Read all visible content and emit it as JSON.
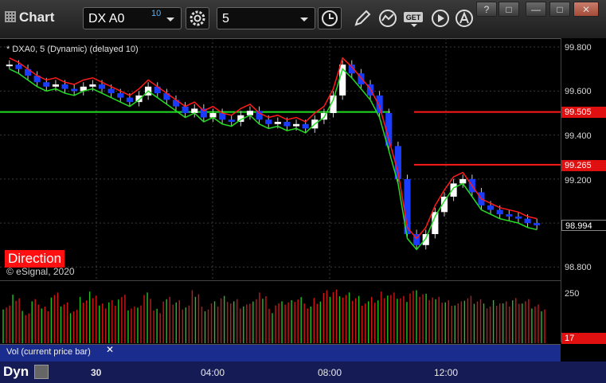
{
  "toolbar": {
    "title": "Chart",
    "symbol": "DX A0",
    "symbol_superscript": "10",
    "interval": "5",
    "window_buttons": [
      "?",
      "□",
      "—",
      "□",
      "✕"
    ]
  },
  "legend": "* DXA0, 5 (Dynamic) (delayed 10)",
  "indicator_label": "Direction",
  "copyright": "© eSignal, 2020",
  "volume_pane": {
    "label": "Vol (current price bar)",
    "close": "✕",
    "y_label": "250",
    "last_tag": "17"
  },
  "bottom": {
    "dyn_label": "Dyn"
  },
  "price_tags": [
    {
      "label": "99.505",
      "color": "#e01010"
    },
    {
      "label": "99.265",
      "color": "#e01010"
    },
    {
      "label": "98.994",
      "color": "#ffffff"
    }
  ],
  "colors": {
    "up": "#ffffff",
    "down": "#1a3cff",
    "red_line": "#ff1a1a",
    "green_line": "#22dd22",
    "vol_up": "#22c022",
    "vol_down": "#d01515"
  },
  "chart_data": {
    "type": "candlestick",
    "ylim": [
      98.74,
      99.84
    ],
    "y_ticks": [
      "99.800",
      "99.600",
      "99.400",
      "99.200",
      "98.800"
    ],
    "x_ticks": [
      "30",
      "04:00",
      "08:00",
      "12:00"
    ],
    "horizontal_levels": [
      {
        "value": 99.505,
        "color": "#ff1a1a"
      },
      {
        "value": 99.265,
        "color": "#ff1a1a"
      }
    ],
    "green_level": 99.505,
    "close_series": [
      99.72,
      99.7,
      99.67,
      99.64,
      99.62,
      99.63,
      99.61,
      99.6,
      99.62,
      99.63,
      99.61,
      99.59,
      99.57,
      99.55,
      99.58,
      99.62,
      99.59,
      99.56,
      99.53,
      99.5,
      99.52,
      99.48,
      99.5,
      99.47,
      99.46,
      99.49,
      99.51,
      99.47,
      99.45,
      99.46,
      99.44,
      99.45,
      99.43,
      99.47,
      99.5,
      99.58,
      99.72,
      99.68,
      99.63,
      99.58,
      99.5,
      99.35,
      99.2,
      98.95,
      98.9,
      98.95,
      99.05,
      99.12,
      99.18,
      99.2,
      99.14,
      99.08,
      99.06,
      99.04,
      99.03,
      99.02,
      99.0,
      98.99
    ],
    "volume_series": [
      180,
      220,
      150,
      200,
      170,
      230,
      190,
      160,
      210,
      240,
      180,
      200,
      220,
      170,
      190,
      230,
      160,
      210,
      200,
      180,
      240,
      170,
      190,
      220,
      200,
      180,
      210,
      230,
      160,
      190,
      200,
      220,
      180,
      210,
      240,
      250,
      230,
      220,
      200,
      210,
      240,
      230,
      220,
      250,
      240,
      230,
      210,
      200,
      190,
      220,
      210,
      180,
      200,
      190,
      210,
      200,
      180,
      170
    ]
  }
}
